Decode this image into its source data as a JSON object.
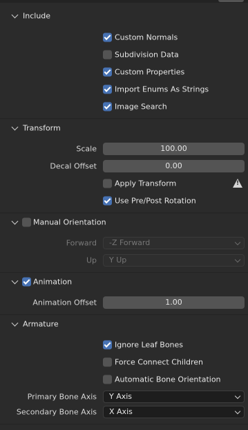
{
  "include": {
    "title": "Include",
    "options": [
      {
        "label": "Custom Normals",
        "checked": true
      },
      {
        "label": "Subdivision Data",
        "checked": false
      },
      {
        "label": "Custom Properties",
        "checked": true
      },
      {
        "label": "Import Enums As Strings",
        "checked": true
      },
      {
        "label": "Image Search",
        "checked": true
      }
    ]
  },
  "transform": {
    "title": "Transform",
    "scale_label": "Scale",
    "scale_value": "100.00",
    "decal_label": "Decal Offset",
    "decal_value": "0.00",
    "apply_transform": {
      "label": "Apply Transform",
      "checked": false
    },
    "use_pre_post": {
      "label": "Use Pre/Post Rotation",
      "checked": true
    }
  },
  "manual_orientation": {
    "title": "Manual Orientation",
    "enabled": false,
    "forward_label": "Forward",
    "forward_value": "-Z Forward",
    "up_label": "Up",
    "up_value": "Y Up"
  },
  "animation": {
    "title": "Animation",
    "enabled": true,
    "offset_label": "Animation Offset",
    "offset_value": "1.00"
  },
  "armature": {
    "title": "Armature",
    "ignore_leaf": {
      "label": "Ignore Leaf Bones",
      "checked": true
    },
    "force_connect": {
      "label": "Force Connect Children",
      "checked": false
    },
    "auto_orient": {
      "label": "Automatic Bone Orientation",
      "checked": false
    },
    "primary_label": "Primary Bone Axis",
    "primary_value": "Y Axis",
    "secondary_label": "Secondary Bone Axis",
    "secondary_value": "X Axis"
  },
  "colors": {
    "accent": "#4772b3",
    "background": "#2b2b2b",
    "field": "#545454",
    "dropdown": "#1d1d1d"
  }
}
